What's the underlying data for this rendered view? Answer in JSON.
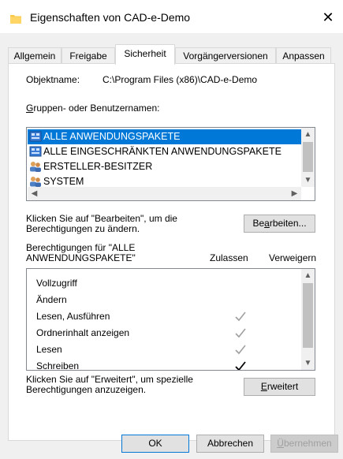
{
  "window": {
    "title": "Eigenschaften von CAD-e-Demo",
    "close_glyph": "✕"
  },
  "tabs": [
    {
      "label": "Allgemein"
    },
    {
      "label": "Freigabe"
    },
    {
      "label": "Sicherheit"
    },
    {
      "label": "Vorgängerversionen"
    },
    {
      "label": "Anpassen"
    }
  ],
  "security": {
    "object_name_label": "Objektname:",
    "object_name_value": "C:\\Program Files (x86)\\CAD-e-Demo",
    "groups_label_u": "G",
    "groups_label_rest": "ruppen- oder Benutzernamen:",
    "principals": [
      {
        "name": "ALLE ANWENDUNGSPAKETE",
        "icon": "app-package-icon",
        "selected": true
      },
      {
        "name": "ALLE EINGESCHRÄNKTEN ANWENDUNGSPAKETE",
        "icon": "app-package-icon",
        "selected": false
      },
      {
        "name": "ERSTELLER-BESITZER",
        "icon": "user-group-icon",
        "selected": false
      },
      {
        "name": "SYSTEM",
        "icon": "user-group-icon",
        "selected": false
      }
    ],
    "edit_hint_1": "Klicken Sie auf \"Bearbeiten\", um die",
    "edit_hint_2": "Berechtigungen zu ändern.",
    "edit_button_pre": "Be",
    "edit_button_u": "a",
    "edit_button_post": "rbeiten...",
    "permissions_for_1": "Berechtigungen für \"ALLE",
    "permissions_for_2": "ANWENDUNGSPAKETE\"",
    "col_allow": "Zulassen",
    "col_deny": "Verweigern",
    "permissions": [
      {
        "name": "Vollzugriff",
        "allow": false,
        "deny": false
      },
      {
        "name": "Ändern",
        "allow": false,
        "deny": false
      },
      {
        "name": "Lesen, Ausführen",
        "allow": "inherited",
        "deny": false
      },
      {
        "name": "Ordnerinhalt anzeigen",
        "allow": "inherited",
        "deny": false
      },
      {
        "name": "Lesen",
        "allow": "inherited",
        "deny": false
      },
      {
        "name": "Schreiben",
        "allow": true,
        "deny": false
      }
    ],
    "advanced_hint_1": "Klicken Sie auf \"Erweitert\", um spezielle",
    "advanced_hint_2": "Berechtigungen anzuzeigen.",
    "advanced_button_u": "E",
    "advanced_button_post": "rweitert"
  },
  "footer": {
    "ok_label": "OK",
    "cancel_label": "Abbrechen",
    "apply_u": "Ü",
    "apply_post": "bernehmen"
  },
  "colors": {
    "selection": "#0078d7",
    "inherited_check": "#a0a0a0"
  }
}
